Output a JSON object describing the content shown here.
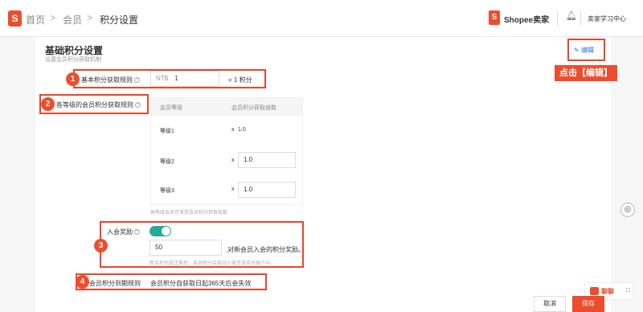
{
  "header": {
    "logo_letter": "S",
    "breadcrumb": [
      "首页",
      "会员",
      "积分设置"
    ],
    "separator": ">",
    "shop_logo_letter": "S",
    "shop_name": "Shopee卖家",
    "learning_center": "卖家学习中心"
  },
  "section": {
    "title": "基础积分设置",
    "subtitle": "设置会员积分获取机制",
    "edit_label": "编辑",
    "tip": "点击【编辑】"
  },
  "annotations": [
    "1",
    "2",
    "3",
    "4"
  ],
  "rules": {
    "basic": {
      "label": "基本积分获取规则",
      "currency": "NT$",
      "amount": "1",
      "equals": "= 1 积分"
    },
    "tier": {
      "label": "各等级的会员积分获取规则",
      "headers": [
        "会员等级",
        "会员积分获取倍数"
      ],
      "rows": [
        {
          "level": "等级1",
          "multiplier_prefix": "x",
          "multiplier": "1.0"
        },
        {
          "level": "等级2",
          "multiplier_prefix": "x",
          "multiplier": "1.0"
        },
        {
          "level": "等级3",
          "multiplier_prefix": "x",
          "multiplier": "1.0"
        }
      ],
      "note": "高等级会员可享受会员积分获取倍数"
    },
    "join": {
      "label": "入会奖励",
      "enabled": true,
      "points": "50",
      "suffix": "对新会员入会的积分奖励。",
      "note": "新会员完成注册后，会员积分会自动入账至该会员账户中。"
    },
    "expiry": {
      "label": "会员积分到期规则",
      "value": "会员积分自获取日起365天后会失效"
    }
  },
  "footer": {
    "cancel": "取消",
    "save": "保存"
  },
  "chat": {
    "label": "聊聊"
  },
  "colors": {
    "brand": "#ee4d2d",
    "toggle_on": "#26aa99",
    "link": "#1a73e8"
  }
}
